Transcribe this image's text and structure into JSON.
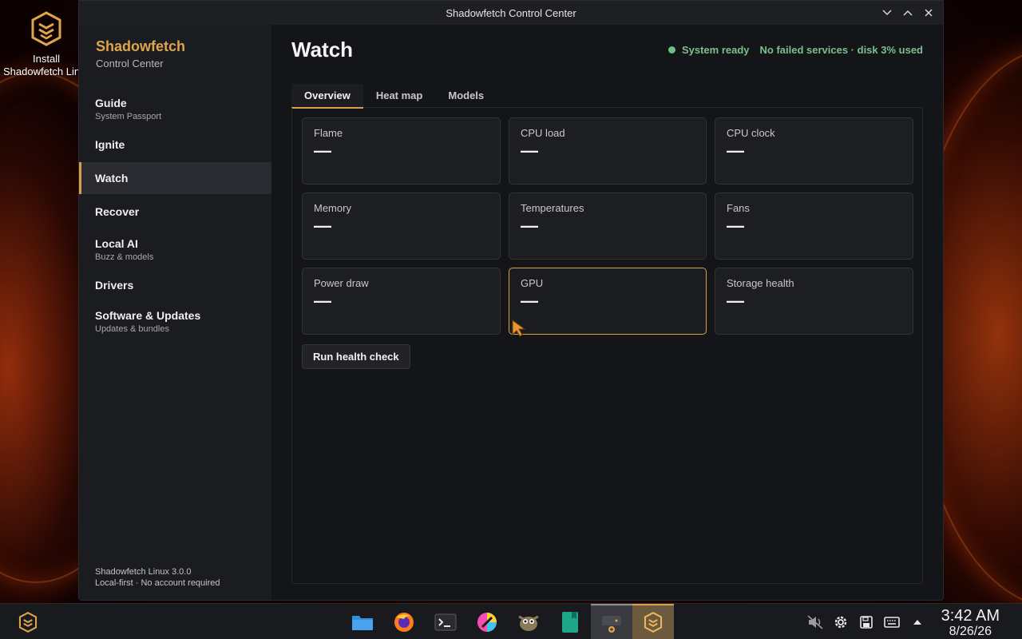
{
  "desktop": {
    "icon_label_line1": "Install",
    "icon_label_line2": "Shadowfetch Linux"
  },
  "window": {
    "title": "Shadowfetch Control Center"
  },
  "sidebar": {
    "brand_name": "Shadowfetch",
    "brand_sub": "Control Center",
    "items": [
      {
        "label": "Guide",
        "sub": "System Passport"
      },
      {
        "label": "Ignite",
        "sub": ""
      },
      {
        "label": "Watch",
        "sub": ""
      },
      {
        "label": "Recover",
        "sub": ""
      },
      {
        "label": "Local AI",
        "sub": "Buzz & models"
      },
      {
        "label": "Drivers",
        "sub": ""
      },
      {
        "label": "Software & Updates",
        "sub": "Updates & bundles"
      }
    ],
    "active": "Watch",
    "footer_version": "Shadowfetch Linux 3.0.0",
    "footer_note": "Local-first · No account required"
  },
  "main": {
    "title": "Watch",
    "status_ready": "System ready",
    "status_detail": "No failed services · disk 3% used",
    "tabs": [
      {
        "label": "Overview"
      },
      {
        "label": "Heat map"
      },
      {
        "label": "Models"
      }
    ],
    "active_tab": "Overview",
    "cards": [
      {
        "title": "Flame",
        "value": "—"
      },
      {
        "title": "CPU load",
        "value": "—"
      },
      {
        "title": "CPU clock",
        "value": "—"
      },
      {
        "title": "Memory",
        "value": "—"
      },
      {
        "title": "Temperatures",
        "value": "—"
      },
      {
        "title": "Fans",
        "value": "—"
      },
      {
        "title": "Power draw",
        "value": "—"
      },
      {
        "title": "GPU",
        "value": "—"
      },
      {
        "title": "Storage health",
        "value": "—"
      }
    ],
    "run_button": "Run health check"
  },
  "taskbar": {
    "apps": [
      "file-manager-icon",
      "firefox-icon",
      "terminal-icon",
      "color-picker-icon",
      "gimp-icon",
      "notes-icon",
      "software-center-icon",
      "shadowfetch-icon"
    ],
    "time": "3:42 AM",
    "date": "8/26/26"
  },
  "colors": {
    "accent": "#d8a04c",
    "status_green": "#7dbf8e",
    "window_bg": "#141518",
    "sidebar_bg": "#1b1c20"
  }
}
